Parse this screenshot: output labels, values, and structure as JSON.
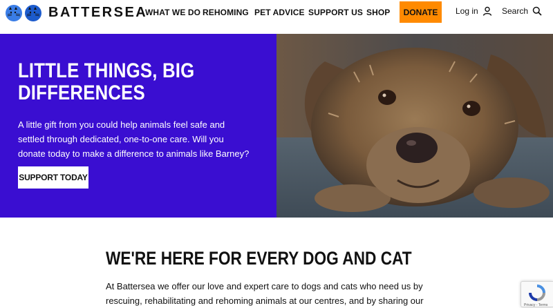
{
  "header": {
    "logo_text": "BATTERSEA",
    "nav": [
      "WHAT WE DO",
      "REHOMING",
      "PET ADVICE",
      "SUPPORT US",
      "SHOP"
    ],
    "donate_label": "DONATE",
    "login_label": "Log in",
    "search_label": "Search",
    "icons": [
      "cat-logo-icon",
      "user-icon",
      "search-icon"
    ]
  },
  "hero": {
    "title": "LITTLE THINGS, BIG DIFFERENCES",
    "body": "A little gift from you could help animals feel safe and settled through dedicated, one-to-one care. Will you donate today to make a difference to animals like Barney?",
    "cta_label": "SUPPORT TODAY",
    "image": "dog-photo"
  },
  "section": {
    "title": "WE'RE HERE FOR EVERY DOG AND CAT",
    "body": "At Battersea we offer our love and expert care to dogs and cats who need us by rescuing, rehabilitating and rehoming animals at our centres, and by sharing our"
  },
  "recaptcha": {
    "label": "Privacy - Terms"
  },
  "colors": {
    "hero_bg": "#3a0ed1",
    "donate_bg": "#ff8a00",
    "logo_blue": "#2a6bd8"
  }
}
